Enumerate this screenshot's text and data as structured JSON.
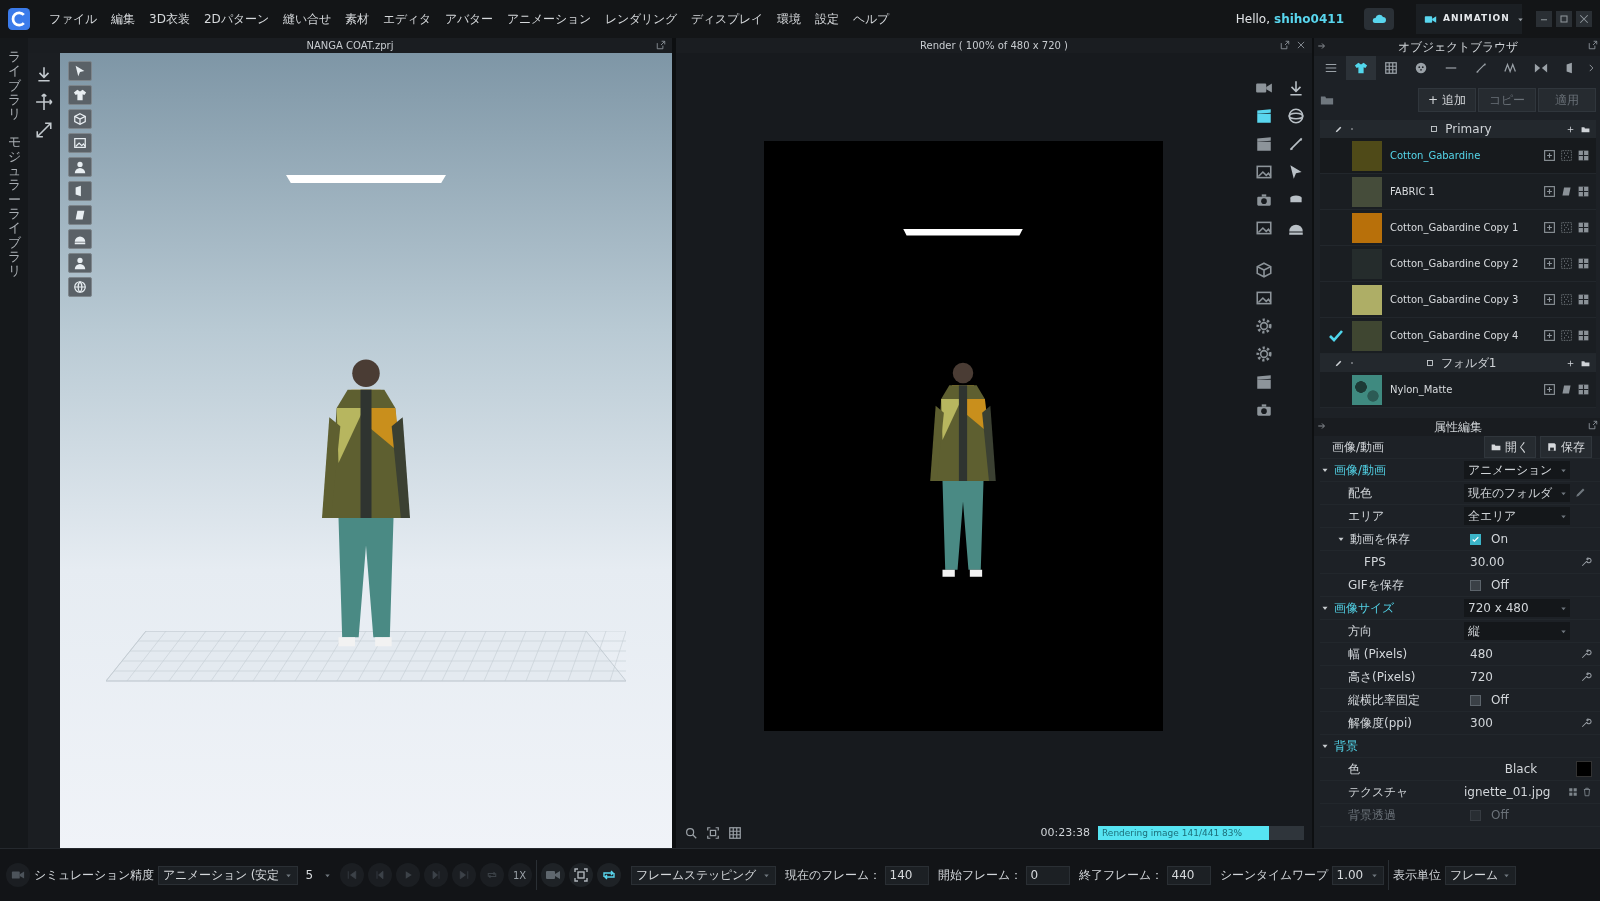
{
  "menu": {
    "items": [
      "ファイル",
      "編集",
      "3D衣装",
      "2Dパターン",
      "縫い合せ",
      "素材",
      "エディタ",
      "アバター",
      "アニメーション",
      "レンダリング",
      "ディスプレイ",
      "環境",
      "設定",
      "ヘルプ"
    ]
  },
  "account": {
    "greeting": "Hello,",
    "user": "shiho0411",
    "mode": "ANIMATION"
  },
  "side_tabs": [
    "ライブラリ",
    "モジュラーライブラリ"
  ],
  "viewport": {
    "title": "NANGA COAT.zprj"
  },
  "render": {
    "title": "Render ( 100% of 480 x 720 )",
    "time": "00:23:38",
    "progress": {
      "text": "Rendering image 141/441  83%",
      "level": 0.83
    }
  },
  "object_browser": {
    "title": "オブジェクトブラウザ",
    "tabs": [
      {
        "selected": false
      },
      {
        "selected": true
      },
      {
        "selected": false
      },
      {
        "selected": false
      },
      {
        "selected": false
      },
      {
        "selected": false
      },
      {
        "selected": false
      },
      {
        "selected": false
      },
      {
        "selected": false
      }
    ],
    "buttons": [
      {
        "label": "+ 追加",
        "disabled": false
      },
      {
        "label": "コピー",
        "disabled": true
      },
      {
        "label": "適用",
        "disabled": true
      }
    ],
    "groups": [
      {
        "name": "Primary",
        "items": [
          {
            "name": "Cotton_Gabardine",
            "kind": "fabric",
            "color": "#4f4a18",
            "selected": true,
            "checked": false
          },
          {
            "name": "FABRIC 1",
            "kind": "preset",
            "color": "#454c3a",
            "selected": false,
            "checked": false
          },
          {
            "name": "Cotton_Gabardine Copy 1",
            "kind": "fabric",
            "color": "#b8700a",
            "selected": false,
            "checked": false
          },
          {
            "name": "Cotton_Gabardine Copy 2",
            "kind": "fabric",
            "color": "#252c2c",
            "selected": false,
            "checked": false
          },
          {
            "name": "Cotton_Gabardine Copy 3",
            "kind": "fabric",
            "color": "#aeae66",
            "selected": false,
            "checked": false
          },
          {
            "name": "Cotton_Gabardine Copy 4",
            "kind": "fabric",
            "color": "#3f4631",
            "selected": false,
            "checked": true
          }
        ]
      },
      {
        "name": "フォルダ1",
        "items": [
          {
            "name": "Nylon_Matte",
            "kind": "texture",
            "color": "#3f8a80",
            "selected": false,
            "checked": false
          }
        ]
      }
    ]
  },
  "property_editor": {
    "title": "属性編集",
    "rows": [
      {
        "kind": "file",
        "label": "画像/動画",
        "buttons": [
          "開く",
          "保存"
        ]
      },
      {
        "kind": "section",
        "label": "画像/動画",
        "value": "アニメーション",
        "expanded": true,
        "children": [
          {
            "kind": "picker",
            "label": "配色",
            "value": "現在のフォルダ"
          },
          {
            "kind": "dropdown",
            "label": "エリア",
            "value": "全エリア"
          },
          {
            "kind": "checkbox",
            "label": "動画を保存",
            "value": "On",
            "checked": true,
            "disabled": false,
            "expanded": true,
            "children": [
              {
                "kind": "number",
                "label": "FPS",
                "value": "30.00"
              }
            ]
          },
          {
            "kind": "checkbox",
            "label": "GIFを保存",
            "value": "Off",
            "checked": false,
            "disabled": false
          }
        ]
      },
      {
        "kind": "section",
        "label": "画像サイズ",
        "value": "720 x 480",
        "expanded": true,
        "children": [
          {
            "kind": "dropdown",
            "label": "方向",
            "value": "縦"
          },
          {
            "kind": "number",
            "label": "幅 (Pixels)",
            "value": "480"
          },
          {
            "kind": "number",
            "label": "高さ(Pixels)",
            "value": "720"
          },
          {
            "kind": "checkbox",
            "label": "縦横比率固定",
            "value": "Off",
            "checked": false,
            "disabled": false
          },
          {
            "kind": "number",
            "label": "解像度(ppi)",
            "value": "300"
          }
        ]
      },
      {
        "kind": "section",
        "label": "背景",
        "expanded": true,
        "children": [
          {
            "kind": "color",
            "label": "色",
            "value": "Black",
            "color": "#000000"
          },
          {
            "kind": "texture",
            "label": "テクスチャ",
            "value": "ignette_01.jpg"
          },
          {
            "kind": "checkbox",
            "label": "背景透過",
            "value": "Off",
            "checked": false,
            "disabled": true
          }
        ]
      }
    ]
  },
  "bottom_bar": {
    "sim_label": "シミュレーション精度",
    "sim_value": "アニメーション (安定",
    "steps": "5",
    "speed": "1X",
    "frame_mode": "フレームステッピング",
    "fields": [
      {
        "label": "現在のフレーム：",
        "value": "140"
      },
      {
        "label": "開始フレーム：",
        "value": "0"
      },
      {
        "label": "終了フレーム：",
        "value": "440"
      },
      {
        "label": "シーンタイムワープ",
        "value": "1.00"
      }
    ],
    "unit_label": "表示単位",
    "unit_value": "フレーム"
  }
}
